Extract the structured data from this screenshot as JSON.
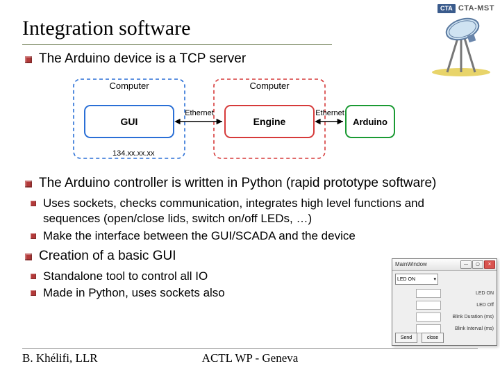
{
  "header": {
    "title": "Integration software",
    "brand_tag": "CTA",
    "brand_text": "CTA-MST"
  },
  "bullets": {
    "b1": "The Arduino device is a TCP server",
    "b2": "The Arduino controller is written in Python (rapid prototype software)",
    "b2_sub1": "Uses sockets, checks communication, integrates high level functions and sequences (open/close lids, switch on/off LEDs, …)",
    "b2_sub2": "Make the interface between the GUI/SCADA and the device",
    "b3": "Creation of a basic GUI",
    "b3_sub1": "Standalone tool to control  all IO",
    "b3_sub2": "Made in Python, uses sockets also"
  },
  "diagram": {
    "computer_left_label": "Computer",
    "computer_right_label": "Computer",
    "gui_label": "GUI",
    "engine_label": "Engine",
    "arduino_label": "Arduino",
    "ethernet_label": "Ethernet",
    "ip_label": "134.xx.xx.xx"
  },
  "gui": {
    "title": "MainWindow",
    "combo": "LED ON",
    "row1": "LED ON",
    "row2": "LED Off",
    "row3": "Blink Duration (ms)",
    "row4": "Blink Interval (ms)",
    "btn1": "Send",
    "btn2": "close"
  },
  "footer": {
    "left": "B. Khélifi, LLR",
    "center": "ACTL WP - Geneva",
    "right": ""
  }
}
